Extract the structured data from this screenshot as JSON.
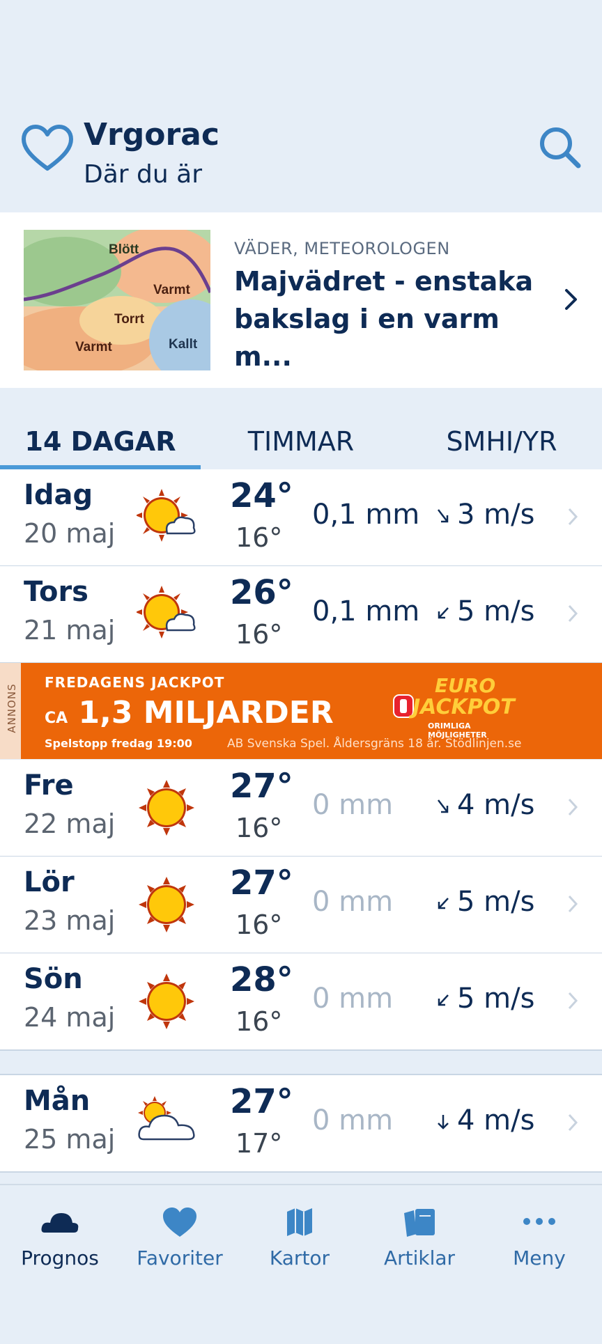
{
  "header": {
    "location_name": "Vrgorac",
    "location_sub": "Där du är",
    "favorite_icon": "heart-outline-icon",
    "search_icon": "search-icon"
  },
  "article": {
    "category": "VÄDER, METEOROLOGEN",
    "title": "Majvädret - enstaka bakslag i en varm m...",
    "map_labels": [
      "Blött",
      "Varmt",
      "Torrt",
      "Varmt",
      "Kallt"
    ]
  },
  "tabs": [
    {
      "label": "14 DAGAR",
      "active": true
    },
    {
      "label": "TIMMAR",
      "active": false
    },
    {
      "label": "SMHI/YR",
      "active": false
    }
  ],
  "forecast": [
    {
      "day": "Idag",
      "date": "20 maj",
      "icon": "sun-cloud-icon",
      "hi": "24°",
      "lo": "16°",
      "rain": "0,1 mm",
      "wind": "3 m/s",
      "wind_dir": "down-right"
    },
    {
      "day": "Tors",
      "date": "21 maj",
      "icon": "sun-cloud-icon",
      "hi": "26°",
      "lo": "16°",
      "rain": "0,1 mm",
      "wind": "5 m/s",
      "wind_dir": "down-left"
    },
    {
      "day": "Fre",
      "date": "22 maj",
      "icon": "sun-icon",
      "hi": "27°",
      "lo": "16°",
      "rain": "0 mm",
      "wind": "4 m/s",
      "wind_dir": "down-right"
    },
    {
      "day": "Lör",
      "date": "23 maj",
      "icon": "sun-icon",
      "hi": "27°",
      "lo": "16°",
      "rain": "0 mm",
      "wind": "5 m/s",
      "wind_dir": "down-left"
    },
    {
      "day": "Sön",
      "date": "24 maj",
      "icon": "sun-icon",
      "hi": "28°",
      "lo": "16°",
      "rain": "0 mm",
      "wind": "5 m/s",
      "wind_dir": "down-left"
    },
    {
      "day": "Mån",
      "date": "25 maj",
      "icon": "cloud-sun-icon",
      "hi": "27°",
      "lo": "17°",
      "rain": "0 mm",
      "wind": "4 m/s",
      "wind_dir": "down"
    }
  ],
  "ad": {
    "tag": "ANNONS",
    "line1": "FREDAGENS JACKPOT",
    "line2_prefix": "CA",
    "line2": "1,3 MILJARDER",
    "line3": "Spelstopp fredag 19:00",
    "legal": "AB Svenska Spel. Åldersgräns 18 år. Stödlinjen.se",
    "logo_top": "EURO",
    "logo_bottom": "JACKPOT",
    "logo_tagline": "ORIMLIGA MÖJLIGHETER"
  },
  "bottom_nav": [
    {
      "label": "Prognos",
      "icon": "cloud-icon",
      "active": true
    },
    {
      "label": "Favoriter",
      "icon": "heart-icon",
      "active": false
    },
    {
      "label": "Kartor",
      "icon": "map-icon",
      "active": false
    },
    {
      "label": "Artiklar",
      "icon": "articles-icon",
      "active": false
    },
    {
      "label": "Meny",
      "icon": "more-icon",
      "active": false
    }
  ],
  "colors": {
    "navy": "#0e2b55",
    "accent_blue": "#4b9ad8",
    "background": "#e6eef7",
    "ad_orange": "#ec6609",
    "sun": "#ffc80a",
    "sun_rays": "#c0360c"
  }
}
